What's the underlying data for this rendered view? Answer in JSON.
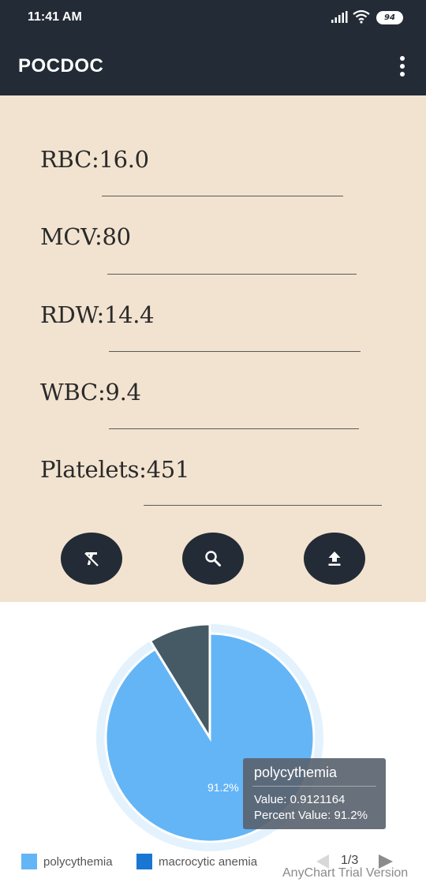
{
  "status_bar": {
    "time": "11:41 AM",
    "battery_level": "94",
    "icons": [
      "signal-icon",
      "wifi-icon",
      "battery-icon"
    ]
  },
  "app_bar": {
    "title": "POCDOC",
    "menu_icon": "more-vert-icon"
  },
  "form": {
    "fields": [
      {
        "label": "RBC:",
        "value": "16.0"
      },
      {
        "label": "MCV:",
        "value": "80"
      },
      {
        "label": "RDW:",
        "value": "14.4"
      },
      {
        "label": "WBC:",
        "value": "9.4"
      },
      {
        "label": "Platelets:",
        "value": "451"
      }
    ],
    "actions": [
      "clear-format-icon",
      "search-icon",
      "upload-icon"
    ]
  },
  "colors": {
    "appbar": "#232b36",
    "form_bg": "#f2e3d0",
    "slice_1": "#64b5f6",
    "slice_2": "#455a64",
    "legend_2": "#1976d2",
    "halo": "#e3f2fd"
  },
  "chart_data": {
    "type": "pie",
    "slices": [
      {
        "name": "polycythemia",
        "value": 0.9121164,
        "percent_label": "91.2%"
      },
      {
        "name": "",
        "value": 0.0878836
      }
    ],
    "legend": {
      "items": [
        {
          "label": "polycythemia",
          "color": "#64b5f6"
        },
        {
          "label": "macrocytic anemia",
          "color": "#1976d2"
        }
      ],
      "page": "1/3"
    },
    "tooltip": {
      "title": "polycythemia",
      "value_line": "Value: 0.9121164",
      "percent_line": "Percent Value: 91.2%"
    },
    "credit": "AnyChart Trial Version"
  }
}
